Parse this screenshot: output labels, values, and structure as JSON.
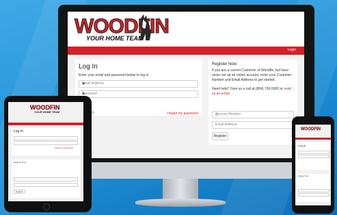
{
  "brand": {
    "name": "WOODFIN",
    "tagline": "YOUR HOME TEAM",
    "accent": "#d42027"
  },
  "nav": {
    "login_label": "Login"
  },
  "login": {
    "title": "Log In",
    "subtitle": "Enter your email and password below to log in.",
    "email_placeholder": "Email Address",
    "password_placeholder": "Password",
    "remember_label": "mber me?",
    "forgot_label": "I forgot my password"
  },
  "register": {
    "title": "Register Now:",
    "text": "If you are a current Customer of Woodfin, but have never set up an online account, enter your Customer Number and Email Address to get started.",
    "help_prefix": "Need help? Give us a call at (804) 730-5000 or",
    "help_link": "send us an email.",
    "account_placeholder": "Account Number",
    "email_placeholder": "Email Address",
    "button_label": "Register"
  },
  "icons": {
    "password_toggle": "eye-icon",
    "account_info": "info-icon"
  }
}
